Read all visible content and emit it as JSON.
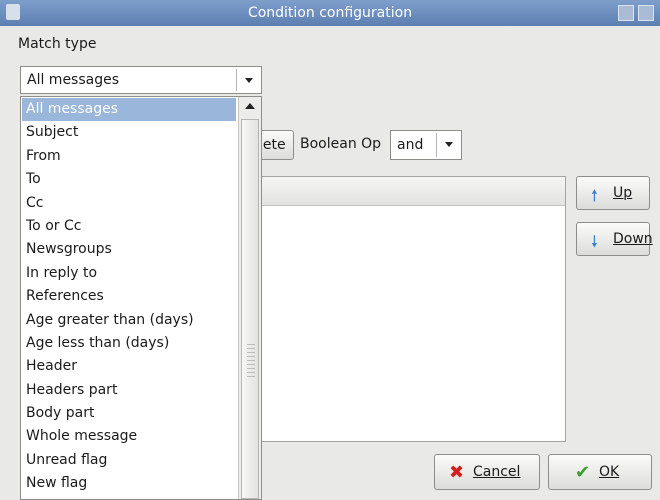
{
  "window": {
    "title": "Condition configuration"
  },
  "match_type": {
    "label": "Match type",
    "selected": "All messages",
    "options": [
      "All messages",
      "Subject",
      "From",
      "To",
      "Cc",
      "To or Cc",
      "Newsgroups",
      "In reply to",
      "References",
      "Age greater than (days)",
      "Age less than (days)",
      "Header",
      "Headers part",
      "Body part",
      "Whole message",
      "Unread flag",
      "New flag"
    ]
  },
  "toolbar": {
    "delete_label": "lete",
    "boolean_label": "Boolean Op",
    "boolean_value": "and"
  },
  "side_buttons": {
    "up_label": "Up",
    "down_label": "Down"
  },
  "footer": {
    "cancel_label": "Cancel",
    "ok_label": "OK"
  },
  "icons": {
    "up": "up-arrow-icon",
    "down": "down-arrow-icon",
    "cancel": "red-x-icon",
    "ok": "green-check-icon"
  },
  "colors": {
    "titlebar": "#6a8bbd",
    "selection": "#9ab6da",
    "up_arrow": "#3b82d1",
    "cancel_icon": "#d0211f",
    "ok_icon": "#3aa22a"
  }
}
